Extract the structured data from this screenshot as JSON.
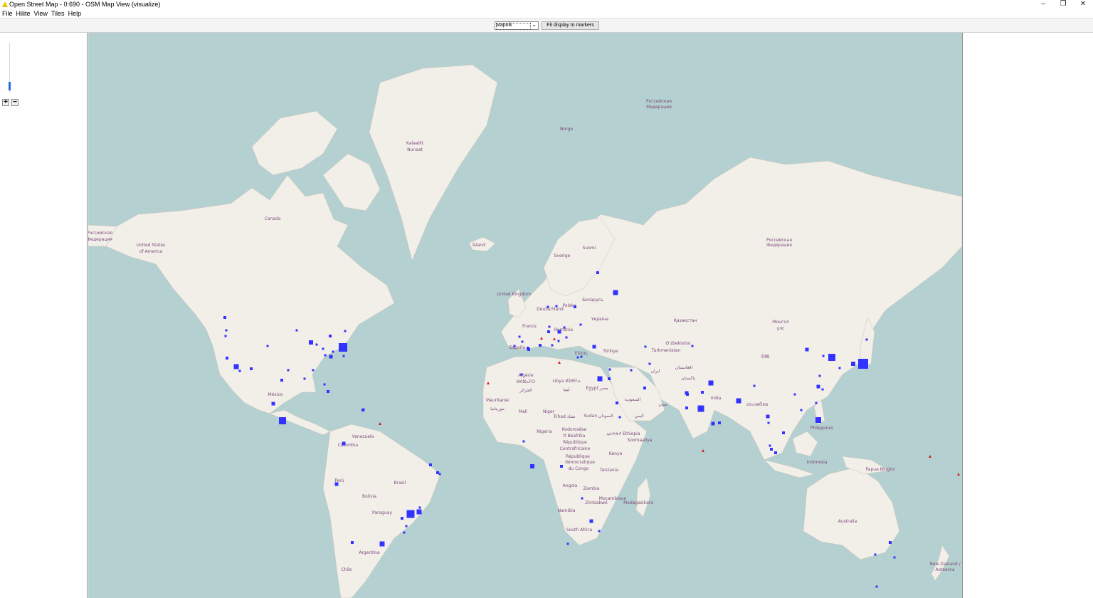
{
  "window": {
    "title": "Open Street Map - 0:690 - OSM Map View (visualize)",
    "minimize": "–",
    "restore": "❐",
    "close": "✕"
  },
  "menu": [
    "File",
    "Hilite",
    "View",
    "Tiles",
    "Help"
  ],
  "toolbar": {
    "tile_source": "Mapnik",
    "fit_button": "Fit display to markers"
  },
  "zoom": {
    "level_fraction": 0.2,
    "zoom_in": "+",
    "zoom_out": "−"
  },
  "colors": {
    "ocean": "#b5d0d0",
    "land": "#f2efe9",
    "marker": "#3333ff",
    "triangle": "#cc2222",
    "border": "#b99cc1"
  },
  "labels": [
    {
      "text": "Kalaallit"
    },
    {
      "text": "Nunaat"
    },
    {
      "text": "Canada"
    },
    {
      "text": "United States"
    },
    {
      "text": "of America"
    },
    {
      "text": "Российская"
    },
    {
      "text": "Федерация"
    },
    {
      "text": "Ísland"
    },
    {
      "text": "Norge"
    },
    {
      "text": "Sverige"
    },
    {
      "text": "Suomi"
    },
    {
      "text": "United Kingdom"
    },
    {
      "text": "Deutschland"
    },
    {
      "text": "Polska"
    },
    {
      "text": "Беларусь"
    },
    {
      "text": "Україна"
    },
    {
      "text": "France"
    },
    {
      "text": "România"
    },
    {
      "text": "España"
    },
    {
      "text": "Türkiye"
    },
    {
      "text": "Қазақстан"
    },
    {
      "text": "Монгол"
    },
    {
      "text": "улс"
    },
    {
      "text": "中国"
    },
    {
      "text": "Oʻzbekiston"
    },
    {
      "text": "Turkmenistan"
    },
    {
      "text": "افغانستان"
    },
    {
      "text": "ایران"
    },
    {
      "text": "پاکستان"
    },
    {
      "text": "India"
    },
    {
      "text": "ประเทศไทย"
    },
    {
      "text": "Philippines"
    },
    {
      "text": "Indonesia"
    },
    {
      "text": "Papua Niugini"
    },
    {
      "text": "Australia"
    },
    {
      "text": "New Zealand /"
    },
    {
      "text": "Aotearoa"
    },
    {
      "text": "México"
    },
    {
      "text": "Venezuela"
    },
    {
      "text": "Colombia"
    },
    {
      "text": "Perú"
    },
    {
      "text": "Brasil"
    },
    {
      "text": "Bolivia"
    },
    {
      "text": "Paraguay"
    },
    {
      "text": "Argentina"
    },
    {
      "text": "Chile"
    },
    {
      "text": "Algérie"
    },
    {
      "text": "ⵍⴷⵣⴰⵢⵔ"
    },
    {
      "text": "الجزائر"
    },
    {
      "text": "Libya ⵍⵉⴱⵢⴰ"
    },
    {
      "text": "ليبيا"
    },
    {
      "text": "Egypt مصر"
    },
    {
      "text": "السعودية"
    },
    {
      "text": "Mauritanie"
    },
    {
      "text": "موريتانيا"
    },
    {
      "text": "Mali"
    },
    {
      "text": "Niger"
    },
    {
      "text": "Tchad تشاد"
    },
    {
      "text": "Sudan السودان"
    },
    {
      "text": "ኢትዮጵያ Ethiopia"
    },
    {
      "text": "Soomaaliya"
    },
    {
      "text": "Nigeria"
    },
    {
      "text": "Kodorosêse"
    },
    {
      "text": "tî Bêafrîka"
    },
    {
      "text": "République"
    },
    {
      "text": "Centrafricaine"
    },
    {
      "text": "République"
    },
    {
      "text": "démocratique"
    },
    {
      "text": "du Congo"
    },
    {
      "text": "Kenya"
    },
    {
      "text": "Tanzania"
    },
    {
      "text": "Angola"
    },
    {
      "text": "Zambia"
    },
    {
      "text": "Moçambique"
    },
    {
      "text": "Zimbabwe"
    },
    {
      "text": "Namibia"
    },
    {
      "text": "South Africa"
    },
    {
      "text": "Madagasikara"
    },
    {
      "text": "اليمن"
    },
    {
      "text": "عمان"
    },
    {
      "text": "Ελλάς"
    },
    {
      "text": "Российская"
    },
    {
      "text": "Федерация"
    },
    {
      "text": "Российская"
    },
    {
      "text": "Федерация"
    }
  ],
  "marker_count": 86,
  "triangle_count": 8
}
